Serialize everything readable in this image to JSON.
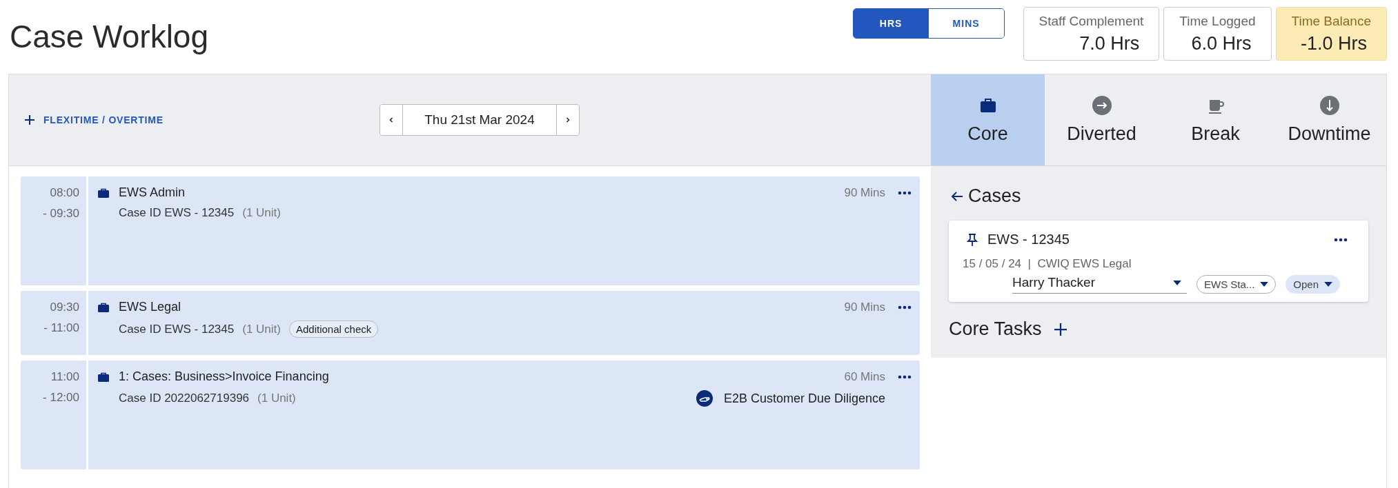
{
  "title": "Case Worklog",
  "unit_toggle": [
    {
      "label": "HRS",
      "selected": true
    },
    {
      "label": "MINS",
      "selected": false
    }
  ],
  "stats": [
    {
      "label": "Staff Complement",
      "value": "7.0 Hrs",
      "kind": "normal"
    },
    {
      "label": "Time Logged",
      "value": "6.0 Hrs",
      "kind": "normal"
    },
    {
      "label": "Time Balance",
      "value": "-1.0 Hrs",
      "kind": "warning"
    }
  ],
  "flexitime_label": "FLEXITIME / OVERTIME",
  "date": "Thu 21st Mar 2024",
  "tabs": [
    {
      "label": "Core",
      "kind": "core",
      "selected": true
    },
    {
      "label": "Diverted",
      "kind": "diverted",
      "selected": false
    },
    {
      "label": "Break",
      "kind": "break",
      "selected": false
    },
    {
      "label": "Downtime",
      "kind": "downtime",
      "selected": false
    }
  ],
  "entries": [
    {
      "start": "08:00",
      "end": "- 09:30",
      "title": "EWS Admin",
      "case_id": "Case ID EWS - 12345",
      "units": "(1 Unit)",
      "duration": "90 Mins"
    },
    {
      "start": "09:30",
      "end": "- 11:00",
      "title": "EWS Legal",
      "case_id": "Case ID EWS - 12345",
      "units": "(1 Unit)",
      "tag": "Additional check",
      "duration": "90 Mins"
    },
    {
      "start": "11:00",
      "end": "- 12:00",
      "title": "1: Cases: Business>Invoice Financing",
      "case_id": "Case ID 2022062719396",
      "units": "(1 Unit)",
      "category": "E2B Customer Due Diligence",
      "duration": "60 Mins"
    }
  ],
  "cases_heading": "Cases",
  "case": {
    "title": "EWS - 12345",
    "meta": "15 / 05 / 24  |  CWIQ EWS Legal",
    "assignee": "Harry Thacker",
    "chips": [
      {
        "label": "EWS Sta...",
        "kind": "outline"
      },
      {
        "label": "Open",
        "kind": "filled"
      }
    ]
  },
  "core_tasks_heading": "Core Tasks"
}
